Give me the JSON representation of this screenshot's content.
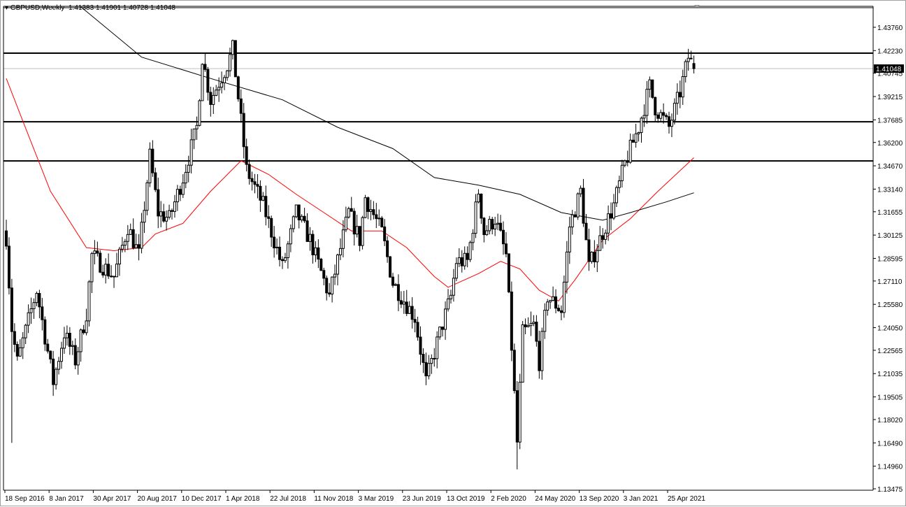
{
  "header": {
    "symbol": "GBPUSD,Weekly",
    "open": "1.41383",
    "high": "1.41901",
    "low": "1.40728",
    "close": "1.41048"
  },
  "chart_data": {
    "type": "candlestick",
    "title": "GBPUSD,Weekly",
    "current_price": 1.41048,
    "current_price_label": "1.41048",
    "ylim": [
      1.13475,
      1.4376
    ],
    "y_ticks": [
      "1.43760",
      "1.42230",
      "1.40745",
      "1.39215",
      "1.37685",
      "1.36200",
      "1.34670",
      "1.33140",
      "1.31655",
      "1.30125",
      "1.28595",
      "1.27110",
      "1.25580",
      "1.24050",
      "1.22565",
      "1.21035",
      "1.19505",
      "1.18020",
      "1.16490",
      "1.14960",
      "1.13475"
    ],
    "x_ticks": [
      {
        "week": 0,
        "label": "18 Sep 2016"
      },
      {
        "week": 16,
        "label": "8 Jan 2017"
      },
      {
        "week": 32,
        "label": "30 Apr 2017"
      },
      {
        "week": 48,
        "label": "20 Aug 2017"
      },
      {
        "week": 64,
        "label": "10 Dec 2017"
      },
      {
        "week": 80,
        "label": "1 Apr 2018"
      },
      {
        "week": 96,
        "label": "22 Jul 2018"
      },
      {
        "week": 112,
        "label": "11 Nov 2018"
      },
      {
        "week": 128,
        "label": "3 Mar 2019"
      },
      {
        "week": 144,
        "label": "23 Jun 2019"
      },
      {
        "week": 160,
        "label": "13 Oct 2019"
      },
      {
        "week": 176,
        "label": "2 Feb 2020"
      },
      {
        "week": 192,
        "label": "24 May 2020"
      },
      {
        "week": 208,
        "label": "13 Sep 2020"
      },
      {
        "week": 224,
        "label": "3 Jan 2021"
      },
      {
        "week": 240,
        "label": "25 Apr 2021"
      }
    ],
    "horizontal_levels": [
      1.4206,
      1.3756,
      1.3499
    ],
    "close_path": [
      [
        0,
        1.3
      ],
      [
        2,
        1.24
      ],
      [
        4,
        1.218
      ],
      [
        9,
        1.252
      ],
      [
        11,
        1.265
      ],
      [
        17,
        1.205
      ],
      [
        21,
        1.237
      ],
      [
        25,
        1.219
      ],
      [
        29,
        1.25
      ],
      [
        31,
        1.288
      ],
      [
        39,
        1.274
      ],
      [
        44,
        1.307
      ],
      [
        48,
        1.288
      ],
      [
        52,
        1.353
      ],
      [
        55,
        1.316
      ],
      [
        59,
        1.312
      ],
      [
        64,
        1.339
      ],
      [
        69,
        1.372
      ],
      [
        71,
        1.418
      ],
      [
        74,
        1.39
      ],
      [
        80,
        1.413
      ],
      [
        82,
        1.423
      ],
      [
        85,
        1.376
      ],
      [
        87,
        1.344
      ],
      [
        93,
        1.321
      ],
      [
        100,
        1.28
      ],
      [
        105,
        1.316
      ],
      [
        110,
        1.298
      ],
      [
        117,
        1.261
      ],
      [
        124,
        1.316
      ],
      [
        128,
        1.298
      ],
      [
        130,
        1.326
      ],
      [
        136,
        1.303
      ],
      [
        140,
        1.27
      ],
      [
        148,
        1.247
      ],
      [
        152,
        1.205
      ],
      [
        157,
        1.237
      ],
      [
        161,
        1.261
      ],
      [
        163,
        1.284
      ],
      [
        167,
        1.284
      ],
      [
        171,
        1.33
      ],
      [
        173,
        1.303
      ],
      [
        177,
        1.312
      ],
      [
        181,
        1.288
      ],
      [
        183,
        1.228
      ],
      [
        185,
        1.165
      ],
      [
        187,
        1.237
      ],
      [
        191,
        1.242
      ],
      [
        193,
        1.218
      ],
      [
        196,
        1.261
      ],
      [
        201,
        1.252
      ],
      [
        204,
        1.307
      ],
      [
        208,
        1.33
      ],
      [
        211,
        1.28
      ],
      [
        216,
        1.303
      ],
      [
        220,
        1.321
      ],
      [
        224,
        1.348
      ],
      [
        229,
        1.372
      ],
      [
        233,
        1.399
      ],
      [
        235,
        1.385
      ],
      [
        240,
        1.372
      ],
      [
        244,
        1.395
      ],
      [
        247,
        1.418
      ],
      [
        249,
        1.411
      ]
    ],
    "extreme_lows": [
      [
        2,
        1.1649
      ],
      [
        185,
        1.1475
      ]
    ],
    "last_candle": {
      "open": 1.41383,
      "high": 1.41901,
      "low": 1.40728,
      "close": 1.41048
    },
    "series": [
      {
        "name": "MA red",
        "color": "#ff0000",
        "points": [
          [
            0,
            1.404
          ],
          [
            6,
            1.376
          ],
          [
            16,
            1.33
          ],
          [
            29,
            1.293
          ],
          [
            39,
            1.291
          ],
          [
            49,
            1.293
          ],
          [
            54,
            1.302
          ],
          [
            64,
            1.309
          ],
          [
            74,
            1.33
          ],
          [
            85,
            1.35
          ],
          [
            95,
            1.341
          ],
          [
            105,
            1.328
          ],
          [
            115,
            1.316
          ],
          [
            125,
            1.304
          ],
          [
            136,
            1.304
          ],
          [
            145,
            1.293
          ],
          [
            155,
            1.274
          ],
          [
            160,
            1.267
          ],
          [
            171,
            1.276
          ],
          [
            179,
            1.284
          ],
          [
            186,
            1.279
          ],
          [
            193,
            1.265
          ],
          [
            200,
            1.258
          ],
          [
            206,
            1.272
          ],
          [
            216,
            1.298
          ],
          [
            226,
            1.312
          ],
          [
            236,
            1.33
          ],
          [
            249,
            1.352
          ]
        ]
      },
      {
        "name": "MA black",
        "color": "#000000",
        "points": [
          [
            27,
            1.451
          ],
          [
            49,
            1.418
          ],
          [
            74,
            1.404
          ],
          [
            100,
            1.39
          ],
          [
            120,
            1.372
          ],
          [
            140,
            1.358
          ],
          [
            155,
            1.339
          ],
          [
            171,
            1.334
          ],
          [
            186,
            1.328
          ],
          [
            201,
            1.316
          ],
          [
            216,
            1.311
          ],
          [
            226,
            1.316
          ],
          [
            239,
            1.323
          ],
          [
            249,
            1.329
          ]
        ]
      }
    ]
  }
}
